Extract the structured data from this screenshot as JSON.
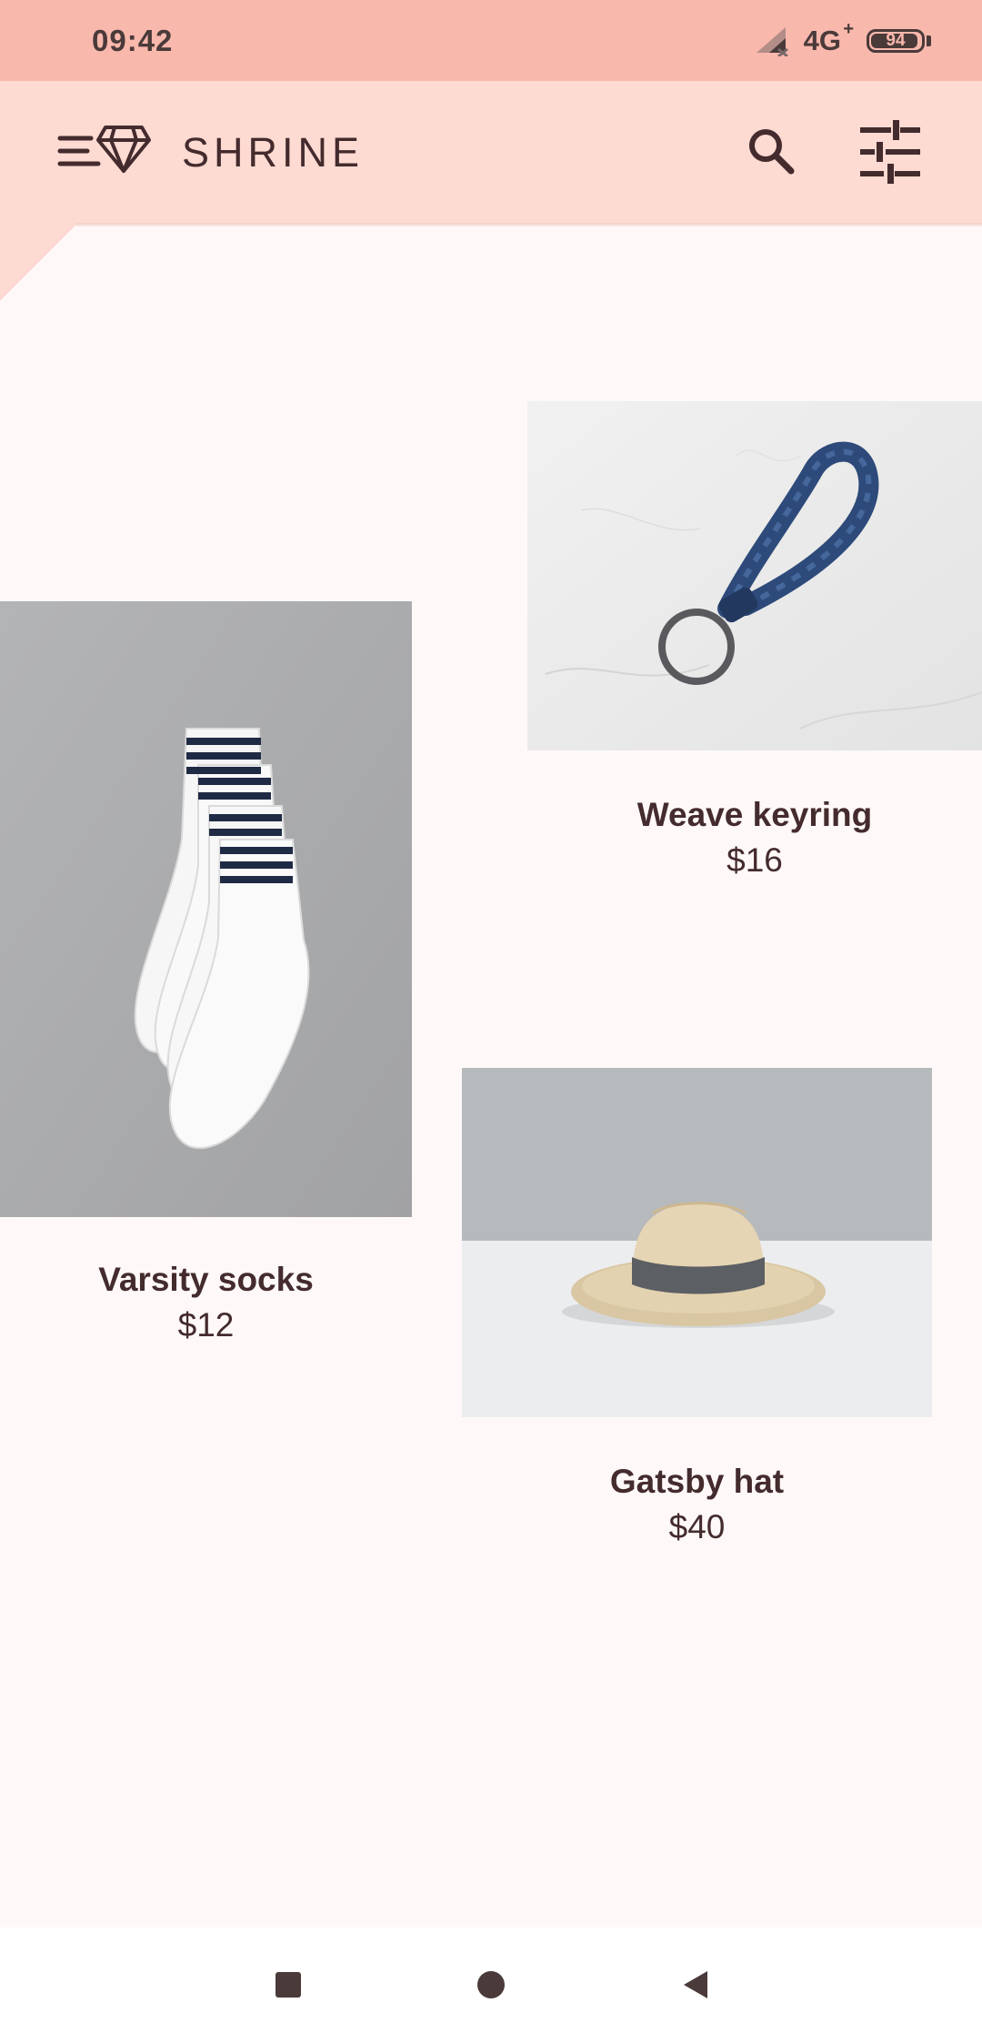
{
  "status_bar": {
    "time": "09:42",
    "network": "4G",
    "network_suffix": "+",
    "battery_level": "94",
    "battery_fraction": 0.94,
    "icons": [
      "signal-icon",
      "battery-icon"
    ]
  },
  "app_bar": {
    "title": "SHRINE",
    "icons": [
      "menu-icon",
      "diamond-logo-icon",
      "search-icon",
      "tune-icon"
    ]
  },
  "products": [
    {
      "name": "Weave keyring",
      "price": "$16",
      "image": "keyring-photo"
    },
    {
      "name": "Varsity socks",
      "price": "$12",
      "image": "socks-photo"
    },
    {
      "name": "Gatsby hat",
      "price": "$40",
      "image": "hat-photo"
    }
  ],
  "nav_bar": {
    "icons": [
      "recents-square-icon",
      "home-circle-icon",
      "back-triangle-icon"
    ]
  },
  "colors": {
    "status_bar": "#F9B8AC",
    "app_bar": "#FDDAD2",
    "surface": "#FEF9F8",
    "text": "#442B2D"
  }
}
